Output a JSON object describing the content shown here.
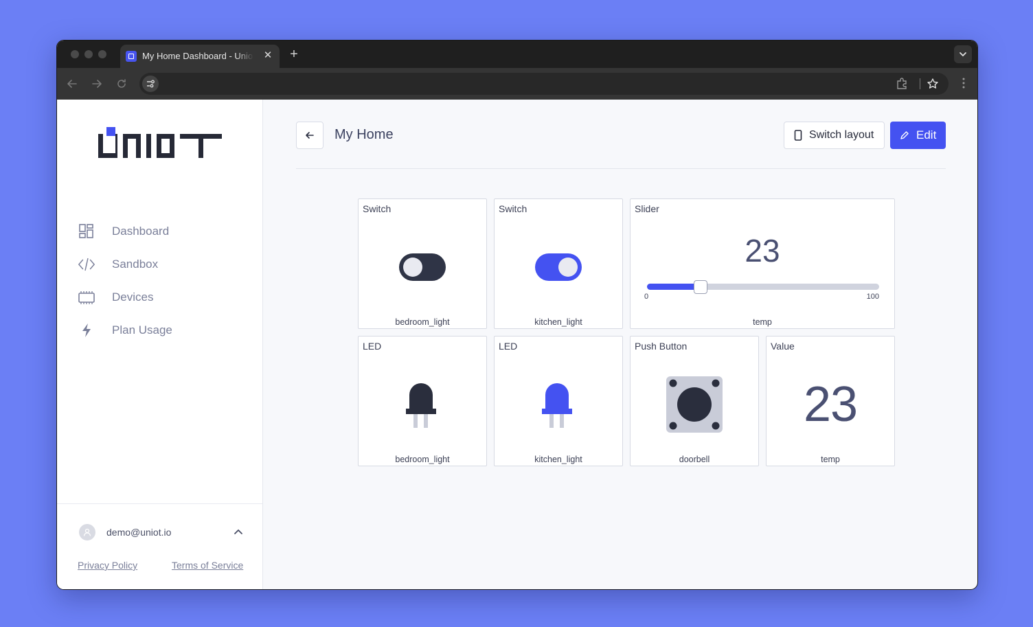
{
  "browser": {
    "tab_title": "My Home Dashboard - Uniot | IoT Platform",
    "new_tab_label": "+",
    "close_label": "✕"
  },
  "sidebar": {
    "logo_text": "UNIOT",
    "items": [
      {
        "label": "Dashboard",
        "icon": "dashboard-icon"
      },
      {
        "label": "Sandbox",
        "icon": "code-icon"
      },
      {
        "label": "Devices",
        "icon": "device-icon"
      },
      {
        "label": "Plan Usage",
        "icon": "lightning-icon"
      }
    ],
    "user_email": "demo@uniot.io",
    "privacy_label": "Privacy Policy",
    "terms_label": "Terms of Service"
  },
  "header": {
    "title": "My Home",
    "switch_layout_label": "Switch layout",
    "edit_label": "Edit"
  },
  "colors": {
    "accent": "#4452f1",
    "dark_widget": "#2f3446",
    "background": "#6b7ff5"
  },
  "widgets": [
    {
      "type": "Switch",
      "name": "bedroom_light",
      "state": "off"
    },
    {
      "type": "Switch",
      "name": "kitchen_light",
      "state": "on"
    },
    {
      "type": "Slider",
      "name": "temp",
      "value": "23",
      "min": "0",
      "max": "100",
      "level": 0.23
    },
    {
      "type": "LED",
      "name": "bedroom_light",
      "state": "off"
    },
    {
      "type": "LED",
      "name": "kitchen_light",
      "state": "on"
    },
    {
      "type": "Push Button",
      "name": "doorbell"
    },
    {
      "type": "Value",
      "name": "temp",
      "value": "23"
    }
  ]
}
